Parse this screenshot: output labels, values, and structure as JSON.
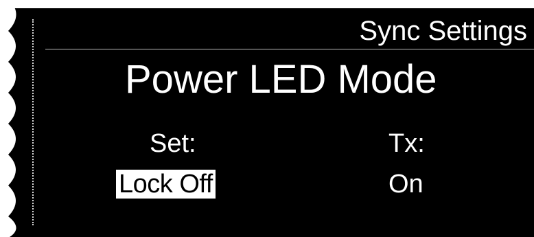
{
  "menu": {
    "title": "Sync Settings"
  },
  "screen": {
    "heading": "Power LED Mode",
    "set_label": "Set:",
    "tx_label": "Tx:",
    "set_value": "Lock Off",
    "tx_value": "On"
  },
  "colors": {
    "background": "#000000",
    "text": "#ffffff",
    "selection_bg": "#ffffff",
    "selection_text": "#000000"
  }
}
